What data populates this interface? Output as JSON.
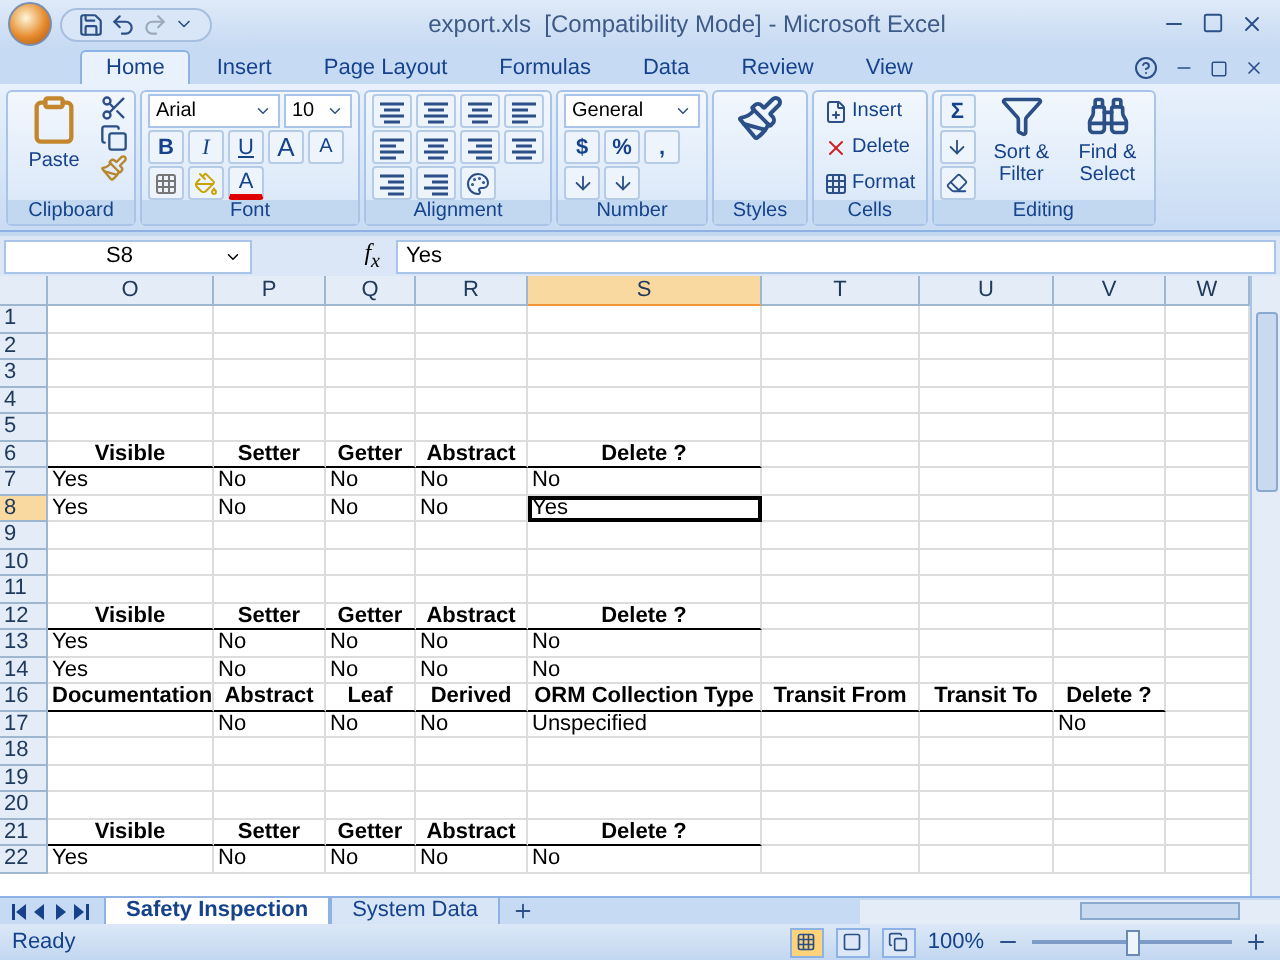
{
  "title_bar": {
    "title": "export.xls  [Compatibility Mode] - Microsoft Excel"
  },
  "ribbon_tabs": [
    {
      "label": "Home",
      "selected": true
    },
    {
      "label": "Insert",
      "selected": false
    },
    {
      "label": "Page Layout",
      "selected": false
    },
    {
      "label": "Formulas",
      "selected": false
    },
    {
      "label": "Data",
      "selected": false
    },
    {
      "label": "Review",
      "selected": false
    },
    {
      "label": "View",
      "selected": false
    }
  ],
  "ribbon": {
    "clipboard": {
      "label": "Clipboard",
      "paste": "Paste"
    },
    "font": {
      "label": "Font",
      "font_name": "Arial",
      "font_size": "10",
      "bold": "B",
      "italic": "I",
      "underline": "U",
      "grow": "A",
      "shrink": "A",
      "font_color": "A"
    },
    "alignment": {
      "label": "Alignment"
    },
    "number": {
      "label": "Number",
      "format": "General",
      "currency": "$",
      "percent": "%",
      "comma": ","
    },
    "styles": {
      "label": "Styles"
    },
    "cells": {
      "label": "Cells",
      "insert": "Insert",
      "delete": "Delete",
      "format": "Format"
    },
    "editing": {
      "label": "Editing",
      "sum": "Σ",
      "sort": "Sort & Filter",
      "find": "Find & Select"
    }
  },
  "formula_bar": {
    "name_box": "S8",
    "function_label": "f$_{x}$",
    "value": "Yes"
  },
  "grid": {
    "columns": [
      {
        "label": "O",
        "selected": false
      },
      {
        "label": "P",
        "selected": false
      },
      {
        "label": "Q",
        "selected": false
      },
      {
        "label": "R",
        "selected": false
      },
      {
        "label": "S",
        "selected": true
      },
      {
        "label": "T",
        "selected": false
      },
      {
        "label": "U",
        "selected": false
      },
      {
        "label": "V",
        "selected": false
      },
      {
        "label": "W",
        "selected": false
      }
    ],
    "rows": [
      {
        "number": "1",
        "selected": false,
        "kind": "data",
        "cells": {}
      },
      {
        "number": "2",
        "selected": false,
        "kind": "data",
        "cells": {}
      },
      {
        "number": "3",
        "selected": false,
        "kind": "data",
        "cells": {}
      },
      {
        "number": "4",
        "selected": false,
        "kind": "data",
        "cells": {}
      },
      {
        "number": "5",
        "selected": false,
        "kind": "data",
        "cells": {}
      },
      {
        "number": "6",
        "selected": false,
        "kind": "header",
        "cells": {
          "O": "Visible",
          "P": "Setter",
          "Q": "Getter",
          "R": "Abstract",
          "S": "Delete ?"
        }
      },
      {
        "number": "7",
        "selected": false,
        "kind": "data",
        "cells": {
          "O": "Yes",
          "P": "No",
          "Q": "No",
          "R": "No",
          "S": "No"
        }
      },
      {
        "number": "8",
        "selected": true,
        "kind": "data",
        "cells": {
          "O": "Yes",
          "P": "No",
          "Q": "No",
          "R": "No",
          "S": "Yes"
        }
      },
      {
        "number": "9",
        "selected": false,
        "kind": "data",
        "cells": {}
      },
      {
        "number": "10",
        "selected": false,
        "kind": "data",
        "cells": {}
      },
      {
        "number": "11",
        "selected": false,
        "kind": "data",
        "cells": {}
      },
      {
        "number": "12",
        "selected": false,
        "kind": "header",
        "cells": {
          "O": "Visible",
          "P": "Setter",
          "Q": "Getter",
          "R": "Abstract",
          "S": "Delete ?"
        }
      },
      {
        "number": "13",
        "selected": false,
        "kind": "data",
        "cells": {
          "O": "Yes",
          "P": "No",
          "Q": "No",
          "R": "No",
          "S": "No"
        }
      },
      {
        "number": "14",
        "selected": false,
        "kind": "data",
        "cells": {
          "O": "Yes",
          "P": "No",
          "Q": "No",
          "R": "No",
          "S": "No"
        }
      },
      {
        "number": "16",
        "selected": false,
        "kind": "header",
        "cells": {
          "O": "Documentation",
          "P": "Abstract",
          "Q": "Leaf",
          "R": "Derived",
          "S": "ORM Collection Type",
          "T": "Transit From",
          "U": "Transit To",
          "V": "Delete ?"
        }
      },
      {
        "number": "17",
        "selected": false,
        "kind": "data",
        "cells": {
          "P": "No",
          "Q": "No",
          "R": "No",
          "S": "Unspecified",
          "V": "No"
        }
      },
      {
        "number": "18",
        "selected": false,
        "kind": "data",
        "cells": {}
      },
      {
        "number": "19",
        "selected": false,
        "kind": "data",
        "cells": {}
      },
      {
        "number": "20",
        "selected": false,
        "kind": "data",
        "cells": {}
      },
      {
        "number": "21",
        "selected": false,
        "kind": "header",
        "cells": {
          "O": "Visible",
          "P": "Setter",
          "Q": "Getter",
          "R": "Abstract",
          "S": "Delete ?"
        }
      },
      {
        "number": "22",
        "selected": false,
        "kind": "data",
        "cells": {
          "O": "Yes",
          "P": "No",
          "Q": "No",
          "R": "No",
          "S": "No"
        }
      }
    ]
  },
  "sheet_tabs": [
    {
      "label": "Safety Inspection",
      "selected": true
    },
    {
      "label": "System Data",
      "selected": false
    }
  ],
  "status_bar": {
    "status": "Ready",
    "views": [
      {
        "kind": "normal",
        "selected": true
      },
      {
        "kind": "page_layout",
        "selected": false
      },
      {
        "kind": "page_break",
        "selected": false
      }
    ],
    "zoom": "100%",
    "level": 0.5
  }
}
